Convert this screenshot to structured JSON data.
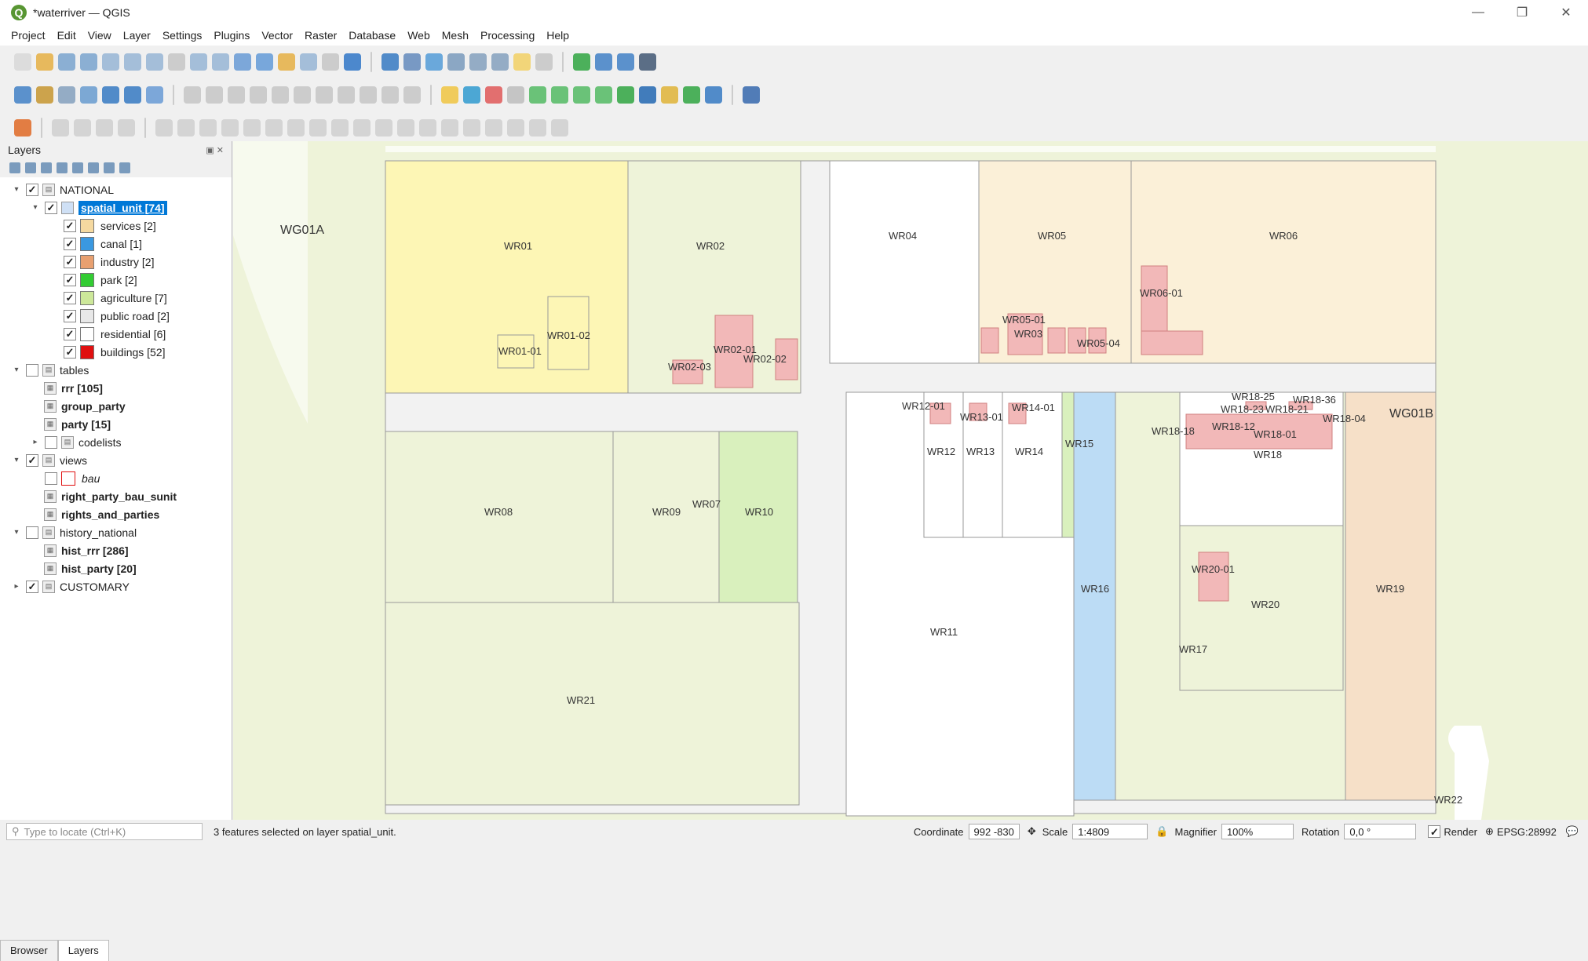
{
  "window": {
    "title": "*waterriver — QGIS",
    "minimize_icon": "—",
    "maximize_icon": "❐",
    "close_icon": "✕"
  },
  "menu": [
    "Project",
    "Edit",
    "View",
    "Layer",
    "Settings",
    "Plugins",
    "Vector",
    "Raster",
    "Database",
    "Web",
    "Mesh",
    "Processing",
    "Help"
  ],
  "layers_panel": {
    "title": "Layers"
  },
  "tree": [
    {
      "level": 0,
      "twisty": "▾",
      "check": "✓",
      "group": true,
      "label": "NATIONAL"
    },
    {
      "level": 1,
      "twisty": "▾",
      "check": "✓",
      "layer": true,
      "selected": true,
      "label": "spatial_unit [74]"
    },
    {
      "level": 2,
      "check": "✓",
      "swatch": "#f5d9a0",
      "label": "services [2]"
    },
    {
      "level": 2,
      "check": "✓",
      "swatch": "#3a98e0",
      "label": "canal [1]"
    },
    {
      "level": 2,
      "check": "✓",
      "swatch": "#e8a070",
      "label": "industry [2]"
    },
    {
      "level": 2,
      "check": "✓",
      "swatch": "#33cc33",
      "label": "park [2]"
    },
    {
      "level": 2,
      "check": "✓",
      "swatch": "#cde89a",
      "label": "agriculture [7]"
    },
    {
      "level": 2,
      "check": "✓",
      "swatch": "#e8e8e8",
      "label": "public road [2]"
    },
    {
      "level": 2,
      "check": "✓",
      "swatch": "#ffffff",
      "label": "residential [6]"
    },
    {
      "level": 2,
      "check": "✓",
      "swatch": "#e01010",
      "label": "buildings [52]"
    },
    {
      "level": 0,
      "twisty": "▾",
      "check": "",
      "group": true,
      "label": "tables"
    },
    {
      "level": 1,
      "table": true,
      "bold": true,
      "label": "rrr [105]"
    },
    {
      "level": 1,
      "table": true,
      "bold": true,
      "label": "group_party"
    },
    {
      "level": 1,
      "table": true,
      "bold": true,
      "label": "party [15]"
    },
    {
      "level": 1,
      "twisty": "▸",
      "check": "",
      "group": true,
      "label": "codelists"
    },
    {
      "level": 0,
      "twisty": "▾",
      "check": "✓",
      "group": true,
      "label": "views"
    },
    {
      "level": 1,
      "check": "",
      "swatch": "#ffffff",
      "swatchborder": "#e01010",
      "italic": true,
      "label": "bau"
    },
    {
      "level": 1,
      "table": true,
      "bold": true,
      "label": "right_party_bau_sunit"
    },
    {
      "level": 1,
      "table": true,
      "bold": true,
      "label": "rights_and_parties"
    },
    {
      "level": 0,
      "twisty": "▾",
      "check": "",
      "group": true,
      "label": "history_national"
    },
    {
      "level": 1,
      "table": true,
      "bold": true,
      "label": "hist_rrr [286]"
    },
    {
      "level": 1,
      "table": true,
      "bold": true,
      "label": "hist_party [20]"
    },
    {
      "level": 0,
      "twisty": "▸",
      "check": "✓",
      "group": true,
      "label": "CUSTOMARY"
    }
  ],
  "panel_tabs": [
    "Browser",
    "Layers"
  ],
  "map_labels": [
    {
      "id": "wg01a",
      "text": "WG01A"
    },
    {
      "id": "wg01b",
      "text": "WG01B"
    },
    {
      "id": "wr01",
      "text": "WR01"
    },
    {
      "id": "wr01_01",
      "text": "WR01-01"
    },
    {
      "id": "wr01_02",
      "text": "WR01-02"
    },
    {
      "id": "wr02",
      "text": "WR02"
    },
    {
      "id": "wr02_01",
      "text": "WR02-01"
    },
    {
      "id": "wr02_02",
      "text": "WR02-02"
    },
    {
      "id": "wr02_03",
      "text": "WR02-03"
    },
    {
      "id": "wr04",
      "text": "WR04"
    },
    {
      "id": "wr05",
      "text": "WR05"
    },
    {
      "id": "wr05_01",
      "text": "WR05-01"
    },
    {
      "id": "wr03",
      "text": "WR03"
    },
    {
      "id": "wr05_04",
      "text": "WR05-04"
    },
    {
      "id": "wr06",
      "text": "WR06"
    },
    {
      "id": "wr06_01",
      "text": "WR06-01"
    },
    {
      "id": "wr12_01",
      "text": "WR12-01"
    },
    {
      "id": "wr13_01",
      "text": "WR13-01"
    },
    {
      "id": "wr14_01",
      "text": "WR14-01"
    },
    {
      "id": "wr12",
      "text": "WR12"
    },
    {
      "id": "wr13",
      "text": "WR13"
    },
    {
      "id": "wr14",
      "text": "WR14"
    },
    {
      "id": "wr15",
      "text": "WR15"
    },
    {
      "id": "wr16",
      "text": "WR16"
    },
    {
      "id": "wr18_25",
      "text": "WR18-25"
    },
    {
      "id": "wr18_36",
      "text": "WR18-36"
    },
    {
      "id": "wr18_23",
      "text": "WR18-23"
    },
    {
      "id": "wr18_21",
      "text": "WR18-21"
    },
    {
      "id": "wr18_04",
      "text": "WR18-04"
    },
    {
      "id": "wr18_18",
      "text": "WR18-18"
    },
    {
      "id": "wr18_12",
      "text": "WR18-12"
    },
    {
      "id": "wr18_01",
      "text": "WR18-01"
    },
    {
      "id": "wr18",
      "text": "WR18"
    },
    {
      "id": "wr08",
      "text": "WR08"
    },
    {
      "id": "wr09",
      "text": "WR09"
    },
    {
      "id": "wr07",
      "text": "WR07"
    },
    {
      "id": "wr10",
      "text": "WR10"
    },
    {
      "id": "wr11",
      "text": "WR11"
    },
    {
      "id": "wr20_01",
      "text": "WR20-01"
    },
    {
      "id": "wr20",
      "text": "WR20"
    },
    {
      "id": "wr19",
      "text": "WR19"
    },
    {
      "id": "wr17",
      "text": "WR17"
    },
    {
      "id": "wr21",
      "text": "WR21"
    },
    {
      "id": "wr22",
      "text": "WR22"
    }
  ],
  "status": {
    "locate_placeholder": "Type to locate (Ctrl+K)",
    "message": "3 features selected on layer spatial_unit.",
    "coordinate_label": "Coordinate",
    "coordinate": "992 -830",
    "scale_label": "Scale",
    "scale": "1:4809",
    "magnifier_label": "Magnifier",
    "magnifier": "100%",
    "rotation_label": "Rotation",
    "rotation": "0,0 °",
    "render_label": "Render",
    "crs": "EPSG:28992"
  },
  "colors": {
    "agriculture": "#eef3d9",
    "services": "#fbf3d0",
    "residential": "#ffffff",
    "road": "#f2f2f2",
    "canal": "#bcdcf5",
    "park": "#d9f0bd",
    "industry": "#f6e0c8",
    "building": "#f2b8b8",
    "wr01": "#fdf6b5"
  }
}
